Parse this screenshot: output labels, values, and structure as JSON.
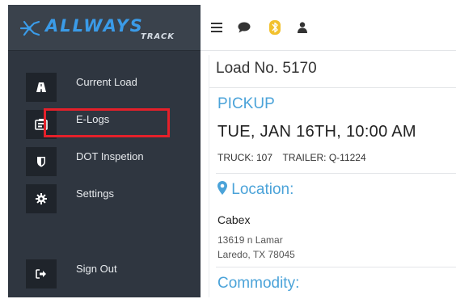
{
  "app": {
    "logo_text": "ALLWAYS",
    "logo_subtext": "TRACK"
  },
  "sidebar": {
    "items": [
      {
        "label": "Current Load",
        "icon": "road-icon"
      },
      {
        "label": "E-Logs",
        "icon": "logbook-icon"
      },
      {
        "label": "DOT Inspetion",
        "icon": "shield-icon"
      },
      {
        "label": "Settings",
        "icon": "gear-icon"
      },
      {
        "label": "Sign Out",
        "icon": "sign-out-icon"
      }
    ],
    "highlighted_item": "E-Logs"
  },
  "topbar": {
    "icons": [
      "menu-icon",
      "chat-icon",
      "bluetooth-icon",
      "user-icon"
    ]
  },
  "load": {
    "title": "Load No. 5170",
    "pickup": {
      "heading": "PICKUP",
      "datetime": "TUE, JAN 16TH, 10:00 AM",
      "truck_label": "TRUCK: 107",
      "trailer_label": "TRAILER: Q-11224"
    },
    "location": {
      "heading": "Location:",
      "name": "Cabex",
      "address_line1": "13619 n Lamar",
      "address_line2": "Laredo, TX 78045"
    },
    "commodity": {
      "heading": "Commodity:"
    }
  },
  "colors": {
    "sidebar_bg": "#2f3640",
    "accent_blue": "#4ba3d9",
    "highlight_red": "#e5202a",
    "bluetooth_yellow": "#f2c12e"
  }
}
